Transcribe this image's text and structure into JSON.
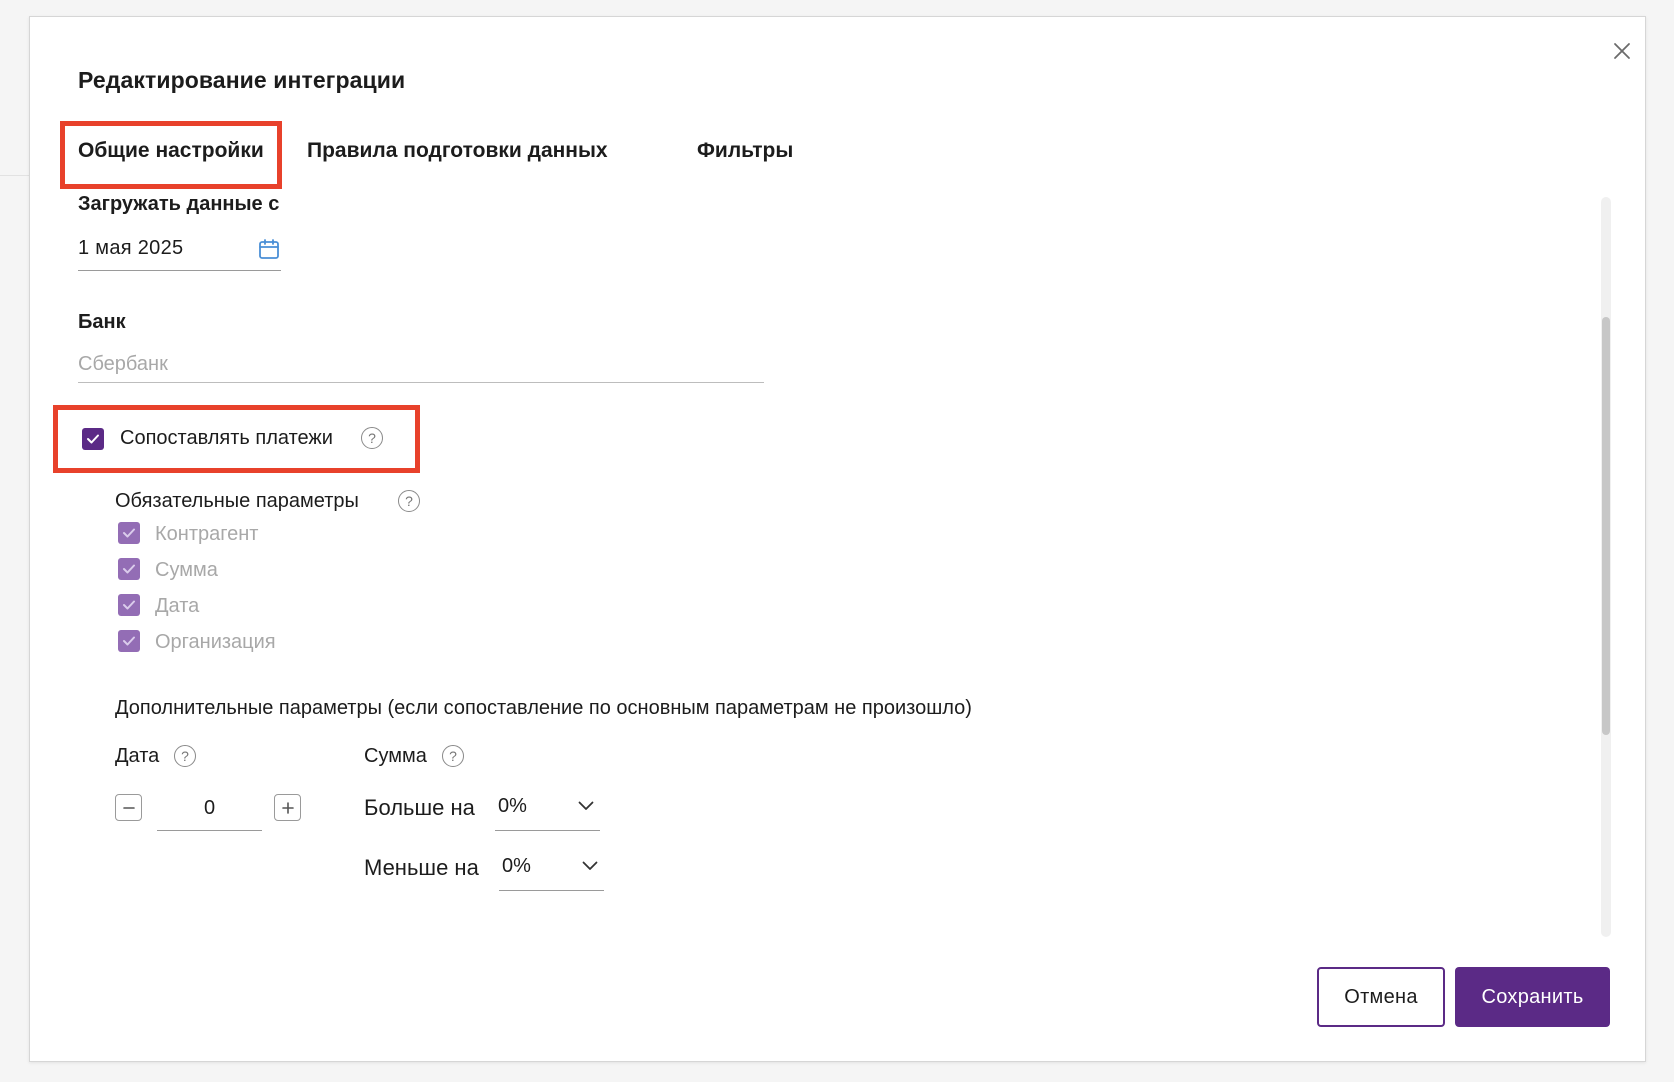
{
  "modal": {
    "title": "Редактирование интеграции",
    "tabs": [
      {
        "label": "Общие настройки",
        "active": true
      },
      {
        "label": "Правила подготовки данных",
        "active": false
      },
      {
        "label": "Фильтры",
        "active": false
      }
    ]
  },
  "general": {
    "load_label": "Загружать данные с",
    "load_date": "1 мая 2025",
    "bank_label": "Банк",
    "bank_value": "Сбербанк",
    "match_payments_label": "Сопоставлять платежи",
    "match_payments_checked": true,
    "required_title": "Обязательные параметры",
    "required_params": [
      {
        "label": "Контрагент",
        "checked": true
      },
      {
        "label": "Сумма",
        "checked": true
      },
      {
        "label": "Дата",
        "checked": true
      },
      {
        "label": "Организация",
        "checked": true
      }
    ],
    "additional_title": "Дополнительные параметры (если сопоставление по основным параметрам не произошло)",
    "date_label": "Дата",
    "date_offset": "0",
    "sum_label": "Сумма",
    "more_label": "Больше на",
    "more_value": "0%",
    "less_label": "Меньше на",
    "less_value": "0%"
  },
  "footer": {
    "cancel_label": "Отмена",
    "save_label": "Сохранить"
  },
  "colors": {
    "accent": "#5b2a86",
    "highlight": "#e8412b"
  },
  "icons": {
    "close": "close-icon",
    "calendar": "calendar-icon",
    "help": "help-icon",
    "check": "check-icon",
    "chevron": "chevron-down-icon"
  }
}
